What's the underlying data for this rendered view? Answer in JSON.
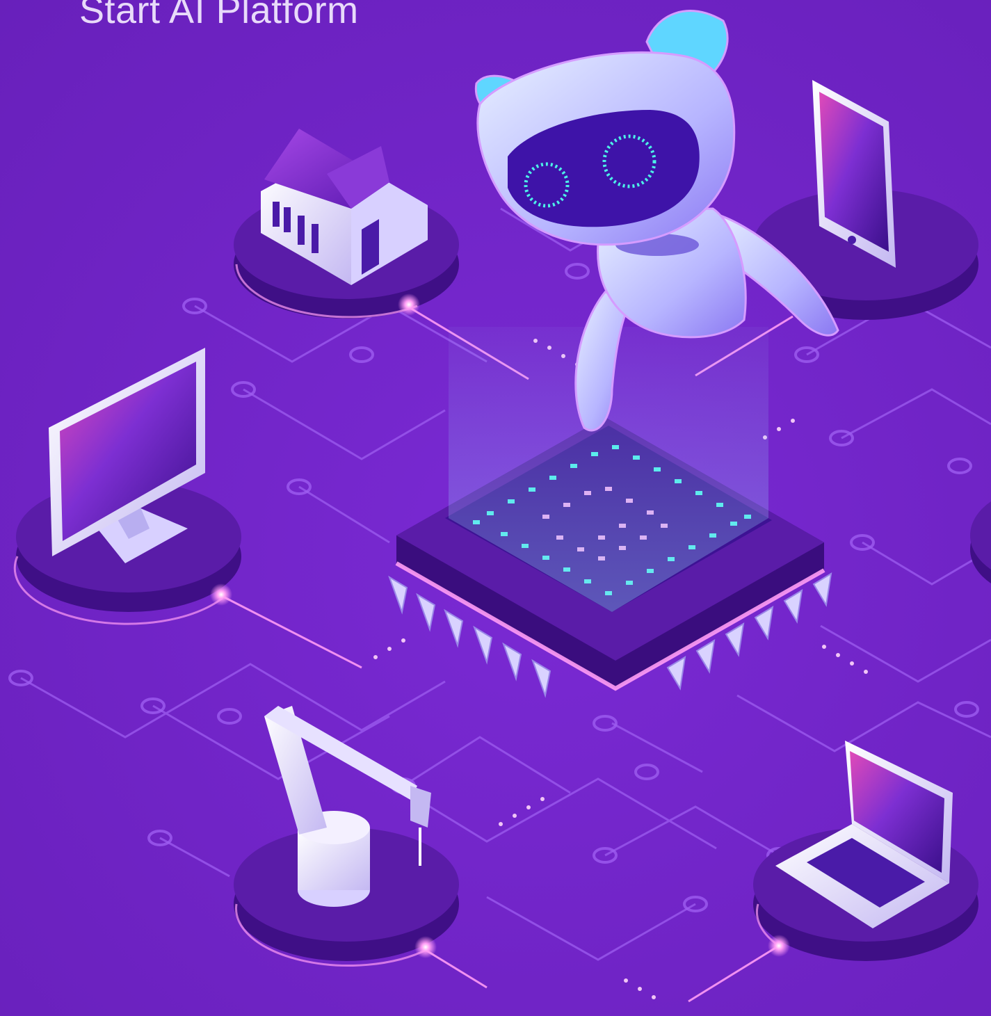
{
  "header": {
    "title": "Start AI Platform"
  },
  "illustration": {
    "center": "ai-chip",
    "mascot": "robot",
    "devices": [
      "house",
      "smartphone",
      "monitor",
      "robotic-arm",
      "laptop"
    ]
  },
  "colors": {
    "background": "#7325c9",
    "circuit": "#9d5df0",
    "platform": "#3f0f86",
    "platform_top": "#5a1ca8",
    "screen": "#5b1fb4",
    "device_body": "#ece8ff",
    "glow": "#ff9cf5",
    "chip_cyan": "#4df0e8",
    "chip_pink": "#f2a6f0"
  }
}
